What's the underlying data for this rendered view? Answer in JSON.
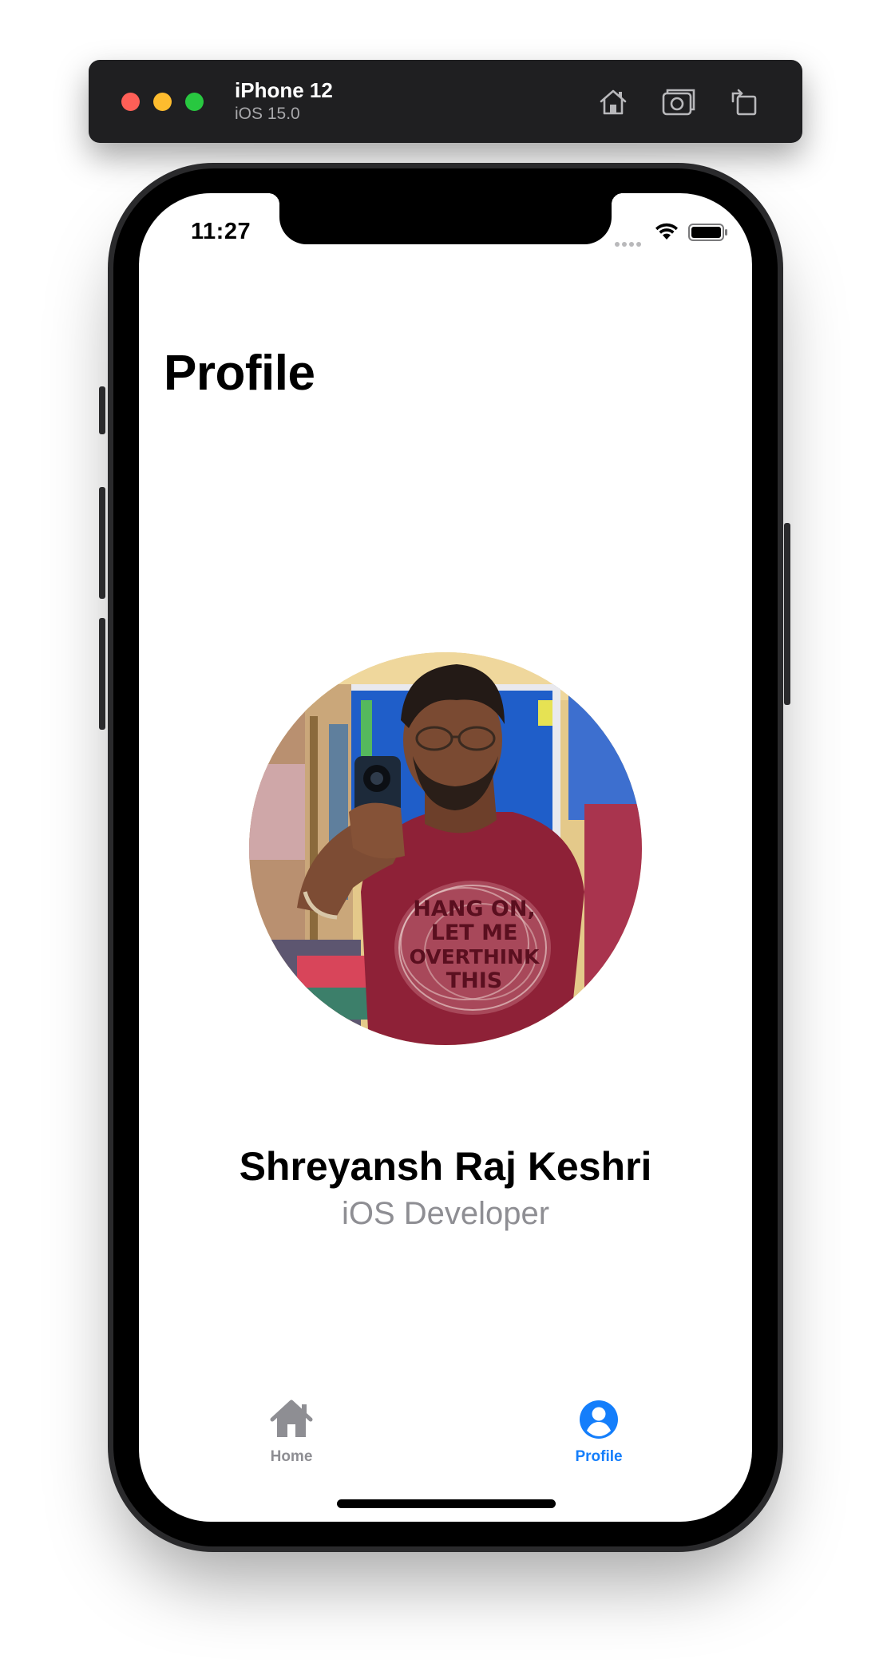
{
  "simulator": {
    "device_name": "iPhone 12",
    "os_version": "iOS 15.0",
    "buttons": {
      "home": "home-icon",
      "screenshot": "camera-icon",
      "rotate": "rotate-icon"
    }
  },
  "status_bar": {
    "time": "11:27",
    "icons": [
      "cellular-signal-icon",
      "wifi-icon",
      "battery-icon"
    ]
  },
  "page": {
    "title": "Profile"
  },
  "profile": {
    "avatar": "profile-photo",
    "name": "Shreyansh Raj Keshri",
    "role": "iOS Developer",
    "shirt_text": [
      "HANG ON,",
      "LET ME",
      "OVERTHINK",
      "THIS"
    ]
  },
  "tab_bar": {
    "tabs": [
      {
        "label": "Home",
        "icon": "house-icon",
        "selected": false
      },
      {
        "label": "Profile",
        "icon": "person-circle-icon",
        "selected": true
      }
    ]
  },
  "colors": {
    "accent": "#147efb",
    "inactive": "#8e8e93",
    "traffic_close": "#ff5f57",
    "traffic_minimize": "#febc2e",
    "traffic_maximize": "#28c840"
  }
}
